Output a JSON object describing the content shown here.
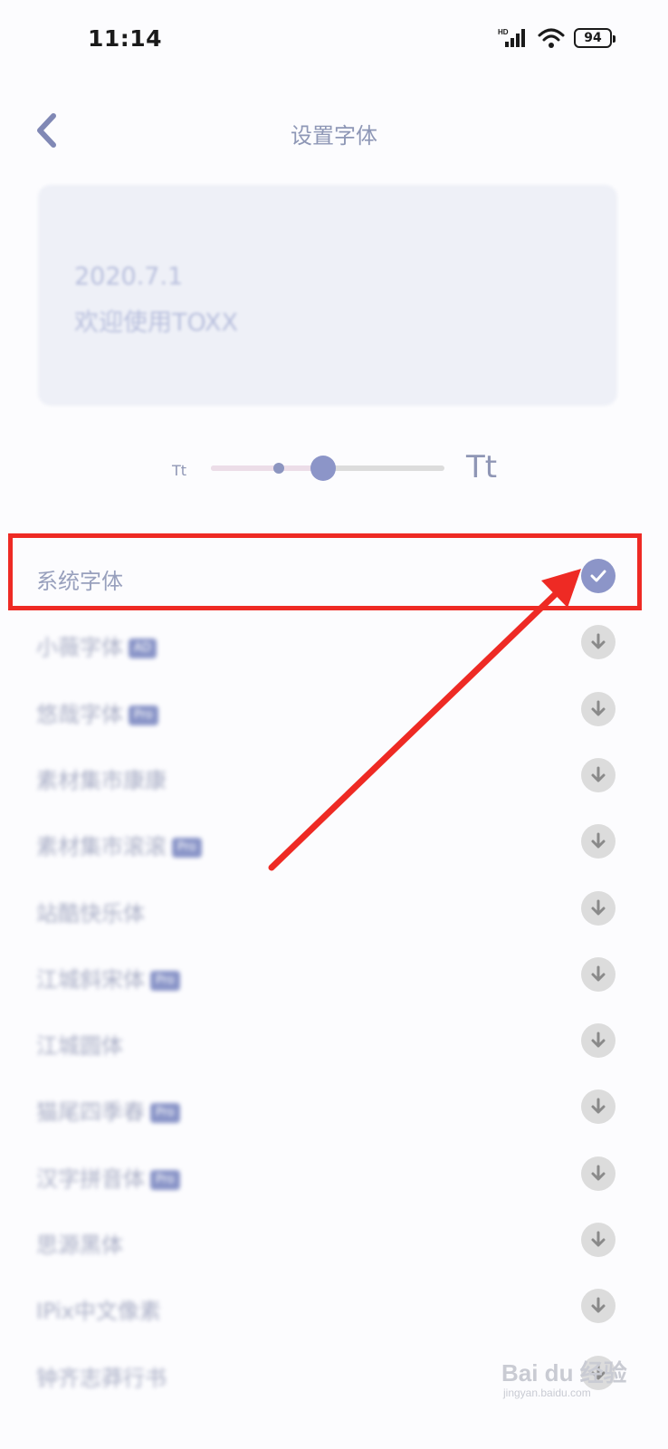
{
  "status_bar": {
    "time": "11:14",
    "battery": "94",
    "network": "HD"
  },
  "header": {
    "title": "设置字体"
  },
  "preview": {
    "date": "2020.7.1",
    "welcome": "欢迎使用TOXX"
  },
  "size_slider": {
    "small_label": "Tt",
    "large_label": "Tt",
    "value_fraction": 0.48,
    "default_fraction": 0.29
  },
  "fonts": [
    {
      "name": "系统字体",
      "badge": "",
      "state": "selected"
    },
    {
      "name": "小薇字体",
      "badge": "AD",
      "state": "download"
    },
    {
      "name": "悠哉字体",
      "badge": "Pro",
      "state": "download"
    },
    {
      "name": "素材集市康康",
      "badge": "",
      "state": "download"
    },
    {
      "name": "素材集市滚滚",
      "badge": "Pro",
      "state": "download"
    },
    {
      "name": "站酷快乐体",
      "badge": "",
      "state": "download"
    },
    {
      "name": "江城斜宋体",
      "badge": "Pro",
      "state": "download"
    },
    {
      "name": "江城圆体",
      "badge": "",
      "state": "download"
    },
    {
      "name": "猫尾四季春",
      "badge": "Pro",
      "state": "download"
    },
    {
      "name": "汉字拼音体",
      "badge": "Pro",
      "state": "download"
    },
    {
      "name": "思源黑体",
      "badge": "",
      "state": "download"
    },
    {
      "name": "IPix中文像素",
      "badge": "",
      "state": "download"
    },
    {
      "name": "钟齐志莽行书",
      "badge": "",
      "state": "download"
    }
  ],
  "annotation": {
    "highlight_color": "#ee2a24"
  },
  "watermark": {
    "text": "Bai du 经验",
    "sub": "jingyan.baidu.com"
  },
  "colors": {
    "accent": "#8c95c8",
    "title": "#8e97b6",
    "download_bg": "#dcdcdc"
  }
}
